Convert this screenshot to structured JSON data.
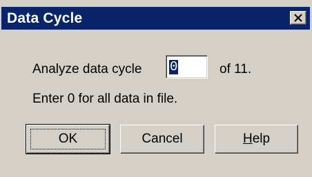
{
  "window": {
    "title": "Data Cycle",
    "close_label": "close"
  },
  "prompt": {
    "label": "Analyze data cycle",
    "value": "0",
    "suffix": "of 11."
  },
  "hint": "Enter 0 for all data in file.",
  "buttons": {
    "ok": "OK",
    "cancel": "Cancel",
    "help": "Help"
  },
  "colors": {
    "titlebar": "#0a246a",
    "dialog_face": "#d4d0c8"
  }
}
